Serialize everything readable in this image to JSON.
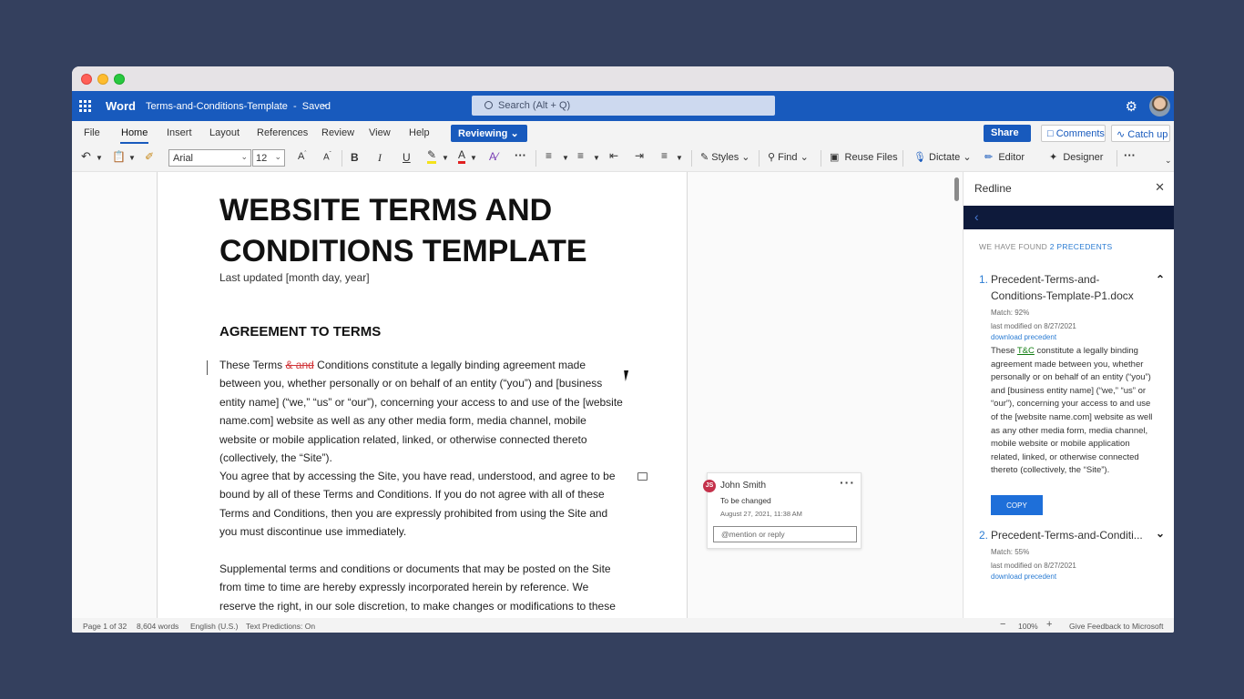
{
  "app": {
    "name": "Word",
    "doc_title": "Terms-and-Conditions-Template",
    "save_state": "Saved",
    "search_placeholder": "Search (Alt + Q)"
  },
  "ribbon": {
    "tabs": [
      "File",
      "Home",
      "Insert",
      "Layout",
      "References",
      "Review",
      "View",
      "Help"
    ],
    "active_tab": "Home",
    "mode": "Reviewing",
    "share": "Share",
    "comments": "Comments",
    "catch_up": "Catch up"
  },
  "toolbar": {
    "font": "Arial",
    "size": "12",
    "styles": "Styles",
    "find": "Find",
    "reuse_files": "Reuse Files",
    "dictate": "Dictate",
    "editor": "Editor",
    "designer": "Designer"
  },
  "document": {
    "title": "WEBSITE TERMS AND CONDITIONS TEMPLATE",
    "updated": "Last updated [month day, year]",
    "heading": "AGREEMENT TO TERMS",
    "p1_a": "These Terms ",
    "p1_del": "& and",
    "p1_b": " Conditions constitute a legally binding agreement made between you, whether personally or on behalf of an entity (“you”) and [business entity name] (“we,” “us” or “our”), concerning your access to and use of the [website name.com] website as well as any other media form, media channel, mobile website or mobile application related, linked, or otherwise connected thereto (collectively, the “Site”).",
    "p2": "You agree that by accessing the Site, you have read, understood, and agree to be bound by all of these Terms and Conditions. If you do not agree with all of these Terms and Conditions, then you are expressly prohibited from using the Site and you must discontinue use immediately.",
    "p3": "Supplemental terms and conditions or documents that may be posted on the Site from time to time are hereby expressly incorporated herein by reference. We reserve the right, in our sole discretion, to make changes or modifications to these Terms and"
  },
  "comment": {
    "initials": "JS",
    "author": "John Smith",
    "text": "To be changed",
    "date": "August 27, 2021, 11:38 AM",
    "reply_placeholder": "@mention or reply"
  },
  "panel": {
    "title": "Redline",
    "found_prefix": "WE HAVE FOUND ",
    "found_count": "2 PRECEDENTS",
    "precedents": [
      {
        "num": "1.",
        "title": "Precedent-Terms-and-Conditions-Template-P1.docx",
        "match": "Match: 92%",
        "modified": "last modified on 8/27/2021",
        "download": "download precedent",
        "excerpt_a": "These ",
        "excerpt_tc": "T&C",
        "excerpt_b": " constitute a legally binding agreement made between you, whether personally or on behalf of an entity (“you”) and [business entity name] (“we,” “us” or “our”), concerning your access to and use of the [website name.com] website as well as any other media form, media channel, mobile website or mobile application related, linked, or otherwise connected thereto (collectively, the “Site”).",
        "copy": "COPY"
      },
      {
        "num": "2.",
        "title": "Precedent-Terms-and-Conditi...",
        "match": "Match: 55%",
        "modified": "last modified on 8/27/2021",
        "download": "download precedent"
      }
    ]
  },
  "status": {
    "page": "Page 1 of 32",
    "words": "8,604 words",
    "language": "English (U.S.)",
    "predictions": "Text Predictions: On",
    "zoom": "100%",
    "feedback": "Give Feedback to Microsoft"
  }
}
